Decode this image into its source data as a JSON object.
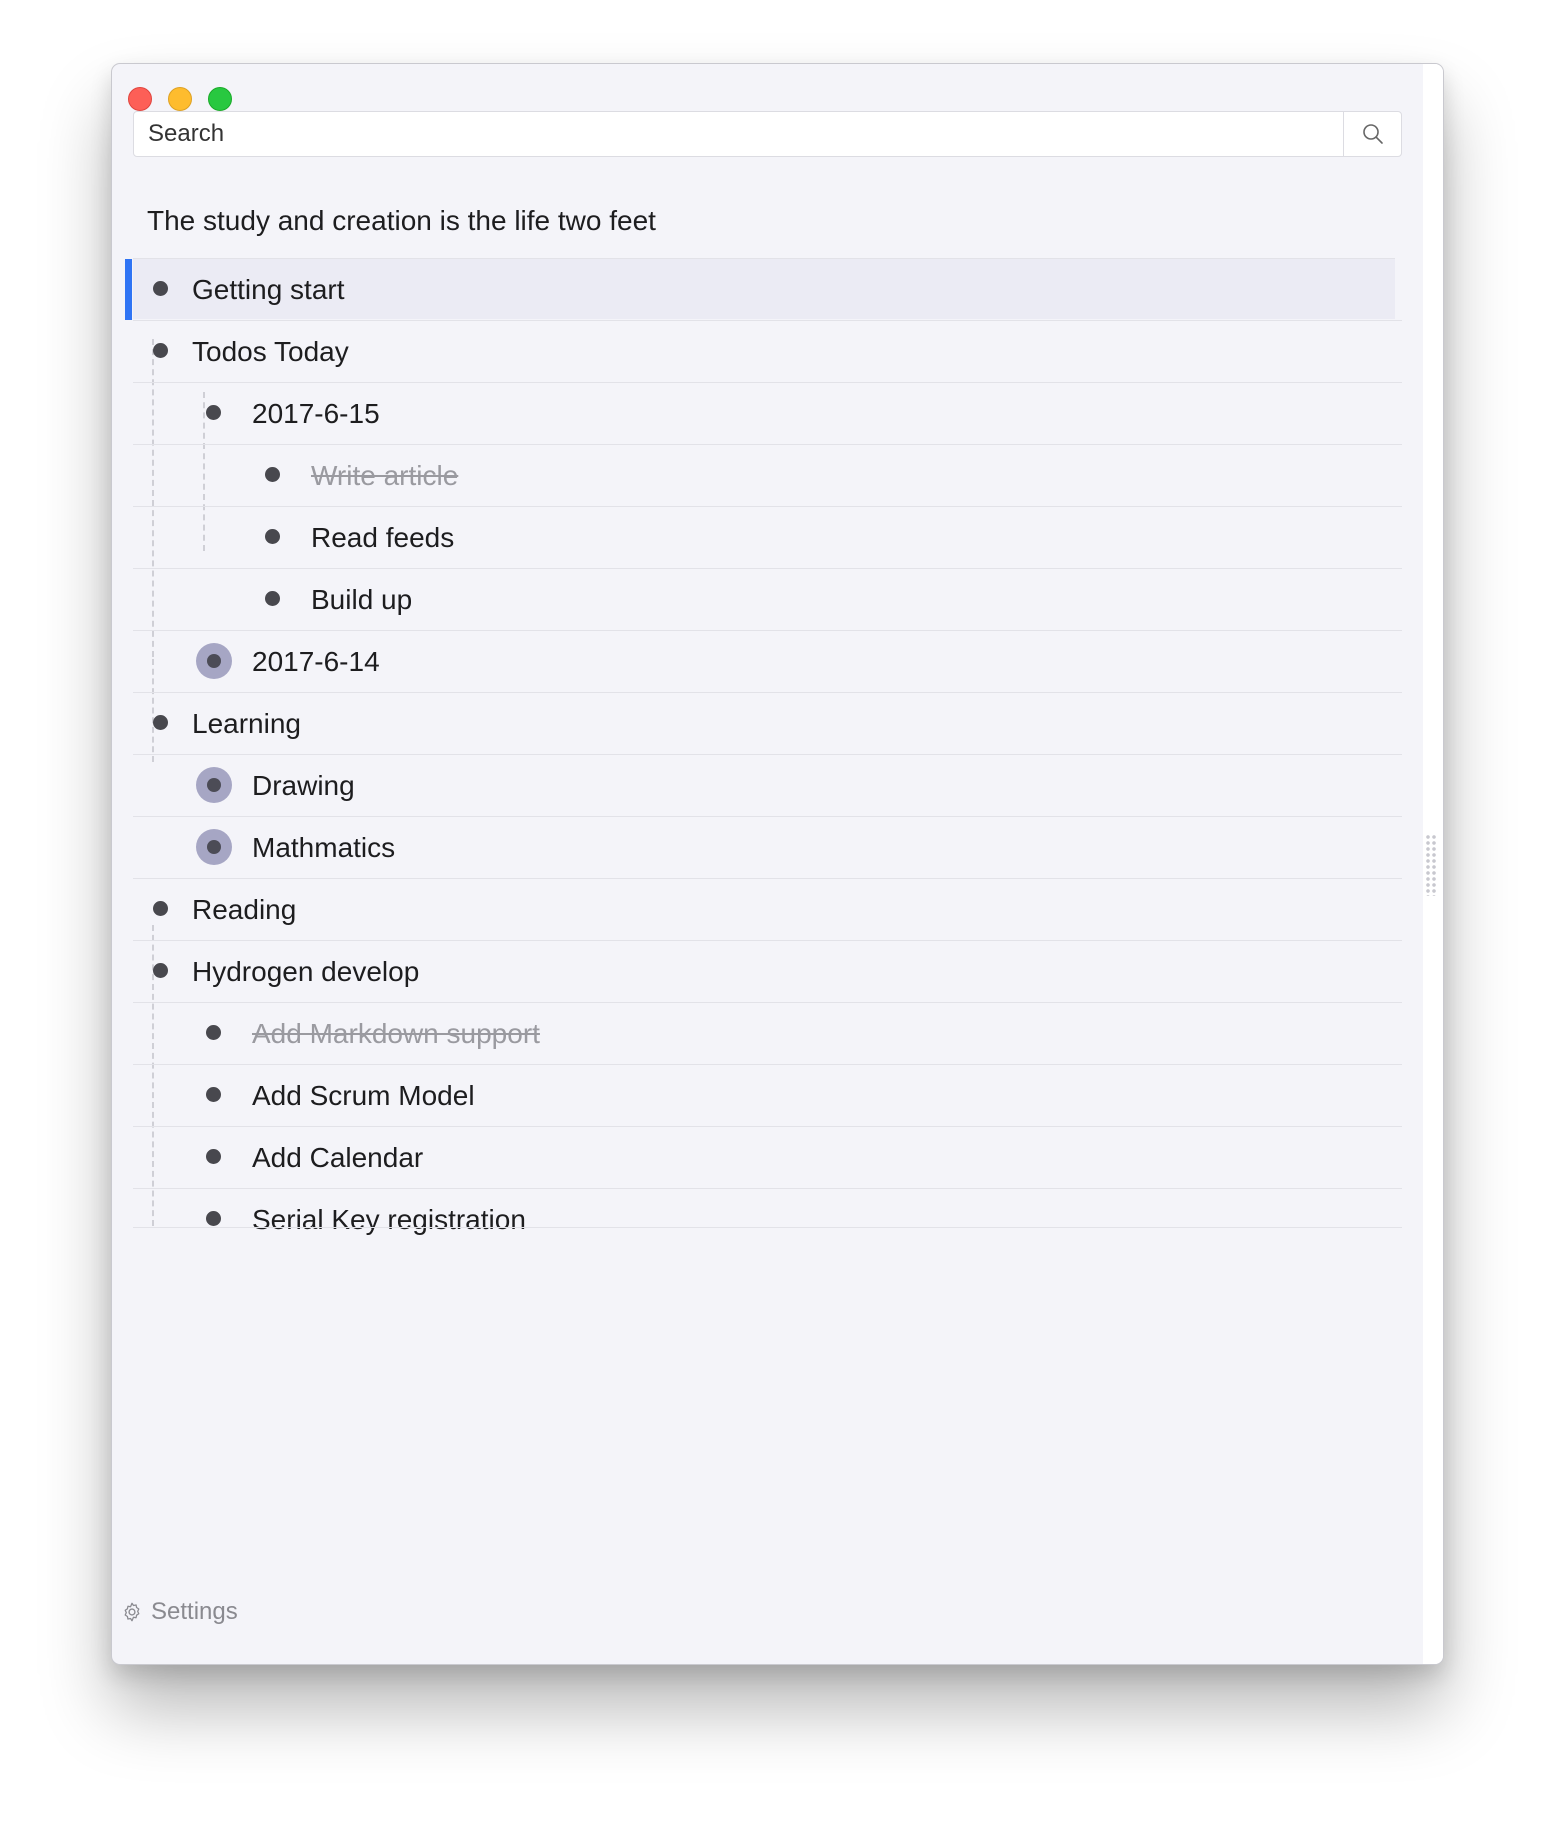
{
  "window": {
    "traffic_lights": [
      "close",
      "minimize",
      "maximize"
    ]
  },
  "search": {
    "placeholder": "Search",
    "icon": "magnifier-icon"
  },
  "tree": {
    "title": "The study and creation is the life two feet",
    "items": [
      {
        "label": "Getting start",
        "level": 0,
        "selected": true,
        "done": false,
        "collapsed": false
      },
      {
        "label": "Todos Today",
        "level": 0,
        "selected": false,
        "done": false,
        "collapsed": false
      },
      {
        "label": "2017-6-15",
        "level": 1,
        "selected": false,
        "done": false,
        "collapsed": false
      },
      {
        "label": "Write article",
        "level": 2,
        "selected": false,
        "done": true,
        "collapsed": false
      },
      {
        "label": "Read feeds",
        "level": 2,
        "selected": false,
        "done": false,
        "collapsed": false
      },
      {
        "label": "Build up",
        "level": 2,
        "selected": false,
        "done": false,
        "collapsed": false
      },
      {
        "label": "2017-6-14",
        "level": 1,
        "selected": false,
        "done": false,
        "collapsed": true
      },
      {
        "label": "Learning",
        "level": 0,
        "selected": false,
        "done": false,
        "collapsed": false
      },
      {
        "label": "Drawing",
        "level": 1,
        "selected": false,
        "done": false,
        "collapsed": true
      },
      {
        "label": "Mathmatics",
        "level": 1,
        "selected": false,
        "done": false,
        "collapsed": true
      },
      {
        "label": "Reading",
        "level": 0,
        "selected": false,
        "done": false,
        "collapsed": false
      },
      {
        "label": "Hydrogen develop",
        "level": 0,
        "selected": false,
        "done": false,
        "collapsed": false
      },
      {
        "label": "Add Markdown support",
        "level": 1,
        "selected": false,
        "done": true,
        "collapsed": false
      },
      {
        "label": "Add Scrum Model",
        "level": 1,
        "selected": false,
        "done": false,
        "collapsed": false
      },
      {
        "label": "Add Calendar",
        "level": 1,
        "selected": false,
        "done": false,
        "collapsed": false
      },
      {
        "label": "Serial Key registration",
        "level": 1,
        "selected": false,
        "done": false,
        "collapsed": false
      }
    ]
  },
  "footer": {
    "settings_label": "Settings",
    "settings_icon": "gear-icon"
  },
  "colors": {
    "accent": "#2f74f4",
    "background": "#f4f4f9",
    "selected_row": "#ebebf4",
    "collapsed_bullet_ring": "#a6a6c4",
    "bullet": "#48484e",
    "done_text": "#9a9aa0"
  }
}
